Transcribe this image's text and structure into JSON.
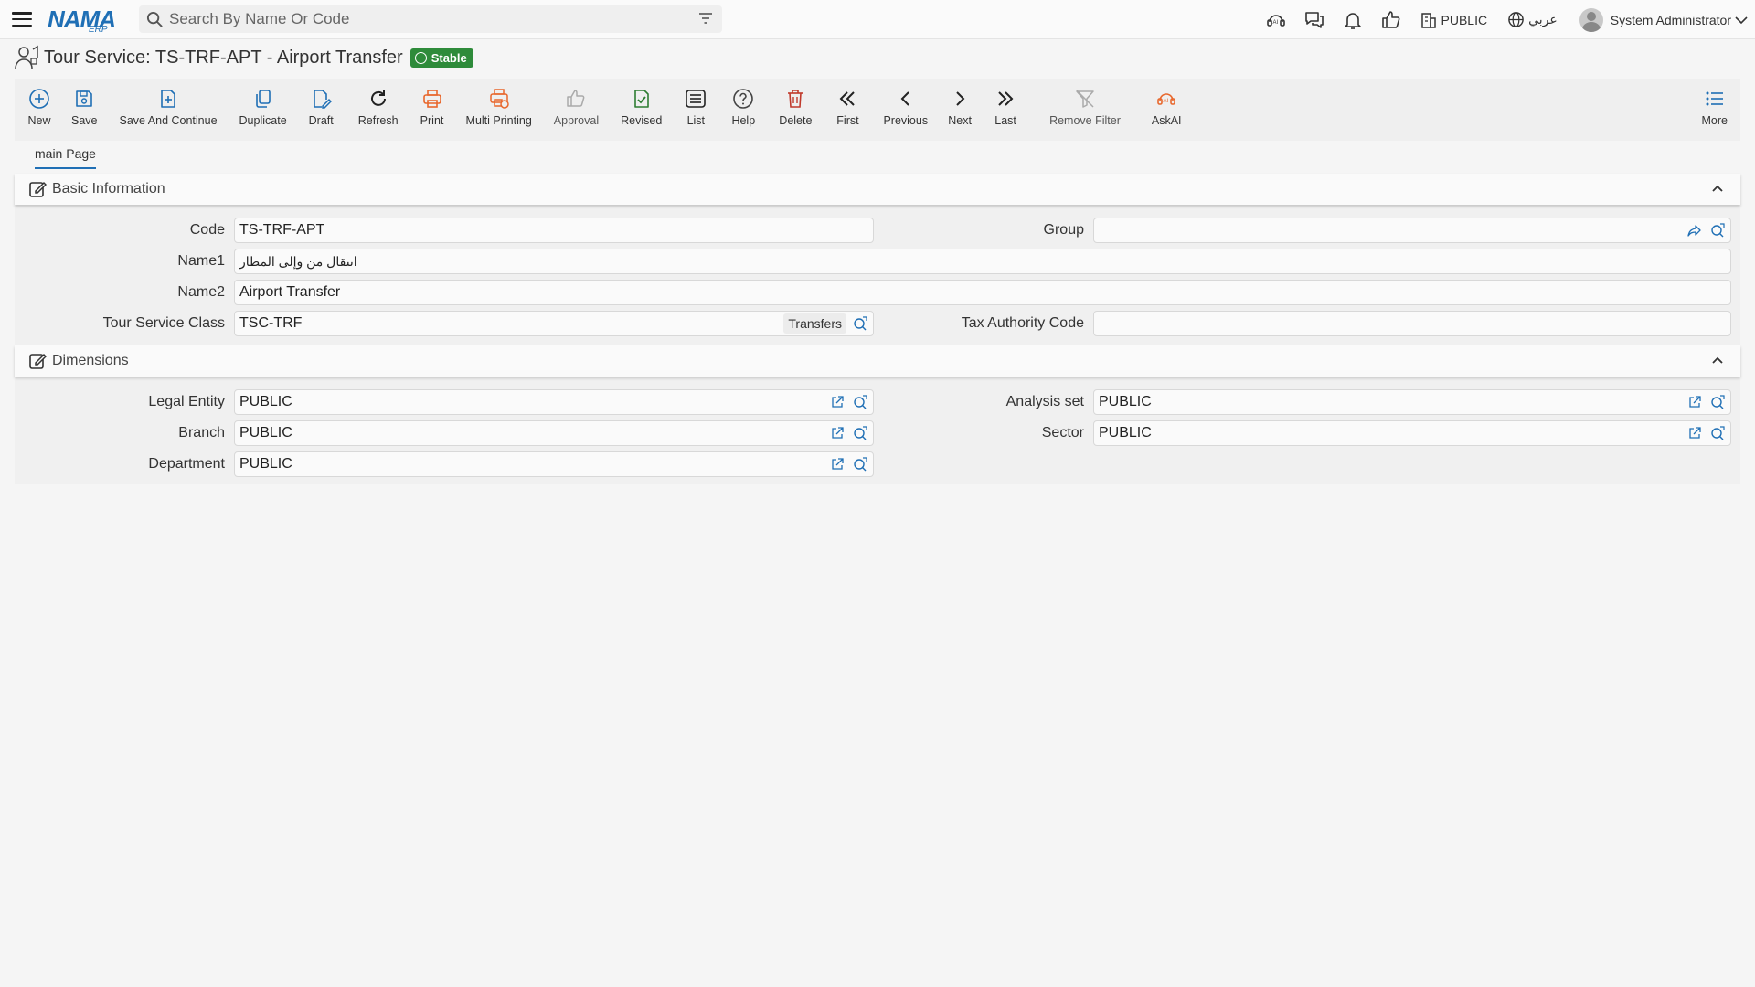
{
  "header": {
    "logo_text": "NAMA",
    "logo_sub": "ERP",
    "search_placeholder": "Search By Name Or Code",
    "context_label": "PUBLIC",
    "language_label": "عربي",
    "user_name": "System Administrator"
  },
  "page": {
    "title": "Tour Service: TS-TRF-APT - Airport Transfer",
    "status": "Stable"
  },
  "toolbar": {
    "buttons": [
      {
        "label": "New",
        "icon": "plus-circle-icon"
      },
      {
        "label": "Save",
        "icon": "save-icon"
      },
      {
        "label": "Save And Continue",
        "icon": "save-continue-icon"
      },
      {
        "label": "Duplicate",
        "icon": "duplicate-icon"
      },
      {
        "label": "Draft",
        "icon": "draft-icon"
      },
      {
        "label": "Refresh",
        "icon": "refresh-icon"
      },
      {
        "label": "Print",
        "icon": "print-icon"
      },
      {
        "label": "Multi Printing",
        "icon": "multi-print-icon"
      },
      {
        "label": "Approval",
        "icon": "thumbs-up-icon"
      },
      {
        "label": "Revised",
        "icon": "revised-icon"
      },
      {
        "label": "List",
        "icon": "list-icon"
      },
      {
        "label": "Help",
        "icon": "help-icon"
      },
      {
        "label": "Delete",
        "icon": "trash-icon"
      },
      {
        "label": "First",
        "icon": "double-chevron-left-icon"
      },
      {
        "label": "Previous",
        "icon": "chevron-left-icon"
      },
      {
        "label": "Next",
        "icon": "chevron-right-icon"
      },
      {
        "label": "Last",
        "icon": "double-chevron-right-icon"
      },
      {
        "label": "Remove Filter",
        "icon": "remove-filter-icon"
      },
      {
        "label": "AskAI",
        "icon": "ai-icon"
      }
    ],
    "more_label": "More"
  },
  "tabs": [
    {
      "label": "main Page",
      "active": true
    }
  ],
  "sections": {
    "basic": {
      "title": "Basic Information",
      "code_label": "Code",
      "code_value": "TS-TRF-APT",
      "group_label": "Group",
      "group_value": "",
      "name1_label": "Name1",
      "name1_value": "انتقال من وإلى المطار",
      "name2_label": "Name2",
      "name2_value": "Airport Transfer",
      "class_label": "Tour Service Class",
      "class_value": "TSC-TRF",
      "class_tag": "Transfers",
      "tax_label": "Tax Authority Code",
      "tax_value": ""
    },
    "dimensions": {
      "title": "Dimensions",
      "legal_label": "Legal Entity",
      "legal_value": "PUBLIC",
      "analysis_label": "Analysis set",
      "analysis_value": "PUBLIC",
      "branch_label": "Branch",
      "branch_value": "PUBLIC",
      "sector_label": "Sector",
      "sector_value": "PUBLIC",
      "department_label": "Department",
      "department_value": "PUBLIC"
    }
  },
  "colors": {
    "brand_blue": "#1f6fb5",
    "stable_green": "#2e8b3a",
    "accent_orange": "#e8672c",
    "delete_red": "#c0392b",
    "revised_green": "#2e7d32"
  }
}
